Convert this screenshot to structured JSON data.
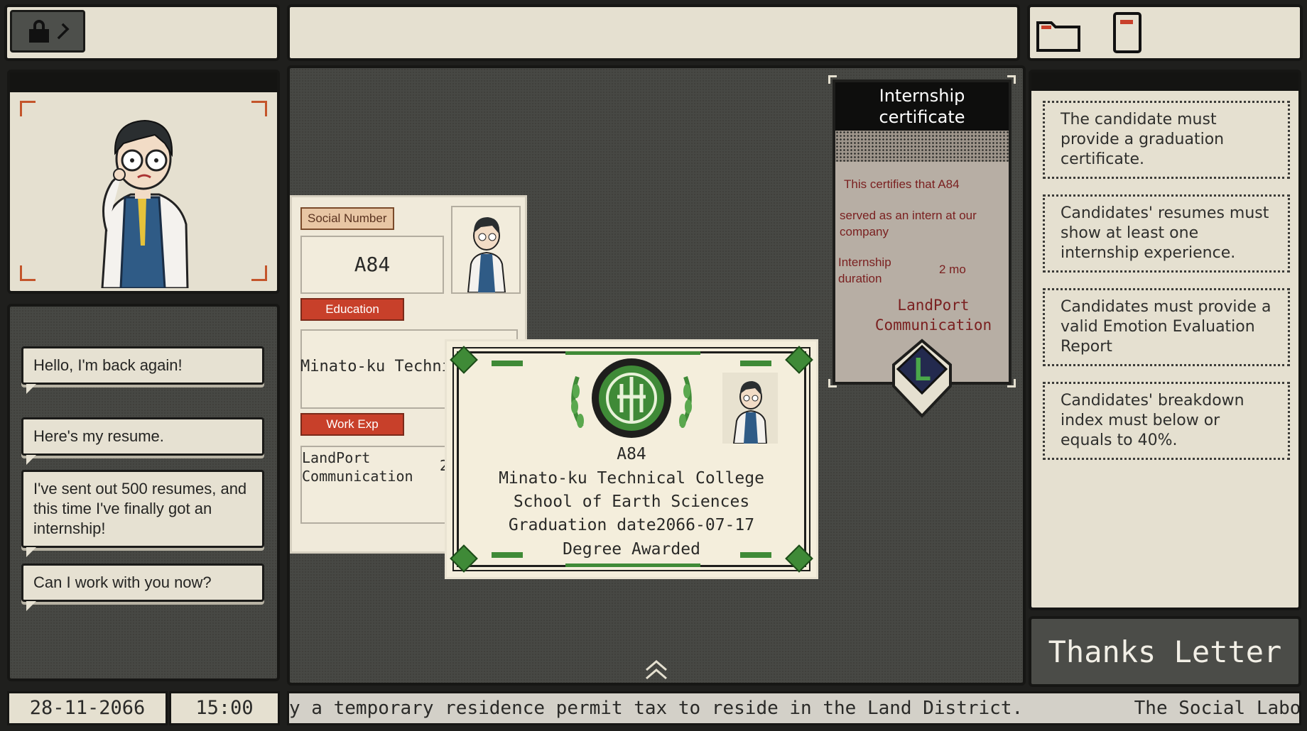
{
  "dialogue": [
    "Hello, I'm back again!",
    "Here's my resume.",
    "I've sent out 500 resumes, and this time I've finally got an internship!",
    "Can I work with you now?"
  ],
  "resume": {
    "social_label": "Social Number",
    "social_value": "A84",
    "education_label": "Education",
    "education_value": "Minato-ku Technic",
    "work_label": "Work Exp",
    "work_value": "LandPort Communication",
    "work_extra": "2"
  },
  "diploma": {
    "id": "A84",
    "school": "Minato-ku Technical College",
    "department": "School of Earth Sciences",
    "graduation": "Graduation date2066-07-17",
    "degree": "Degree Awarded"
  },
  "cert": {
    "title": "Internship certificate",
    "line1": "This certifies that A84",
    "line2": "served as an intern at our company",
    "duration_label": "Internship duration",
    "duration_value": "2 mo",
    "company": "LandPort Communication",
    "logo_letter": "L"
  },
  "rules": [
    "The candidate must provide a graduation certificate.",
    "Candidates' resumes must show at least one internship experience.",
    "Candidates must provide a valid Emotion Evaluation Report",
    "Candidates' breakdown index must below or equals to  40%."
  ],
  "buttons": {
    "thanks": "Thanks Letter"
  },
  "status": {
    "date": "28-11-2066",
    "time": "15:00",
    "ticker": "y a temporary residence permit tax to reside in the Land District.          The Social Labour Departme"
  },
  "icons": {
    "lock": "lock-icon",
    "forward": "chevron-right-icon",
    "folder": "folder-icon",
    "document": "document-icon",
    "up": "double-chevron-up-icon"
  },
  "colors": {
    "tag_red": "#c8402a",
    "corner_orange": "#c4552b",
    "diploma_green": "#3f8a37",
    "cert_text": "#7a2020"
  }
}
